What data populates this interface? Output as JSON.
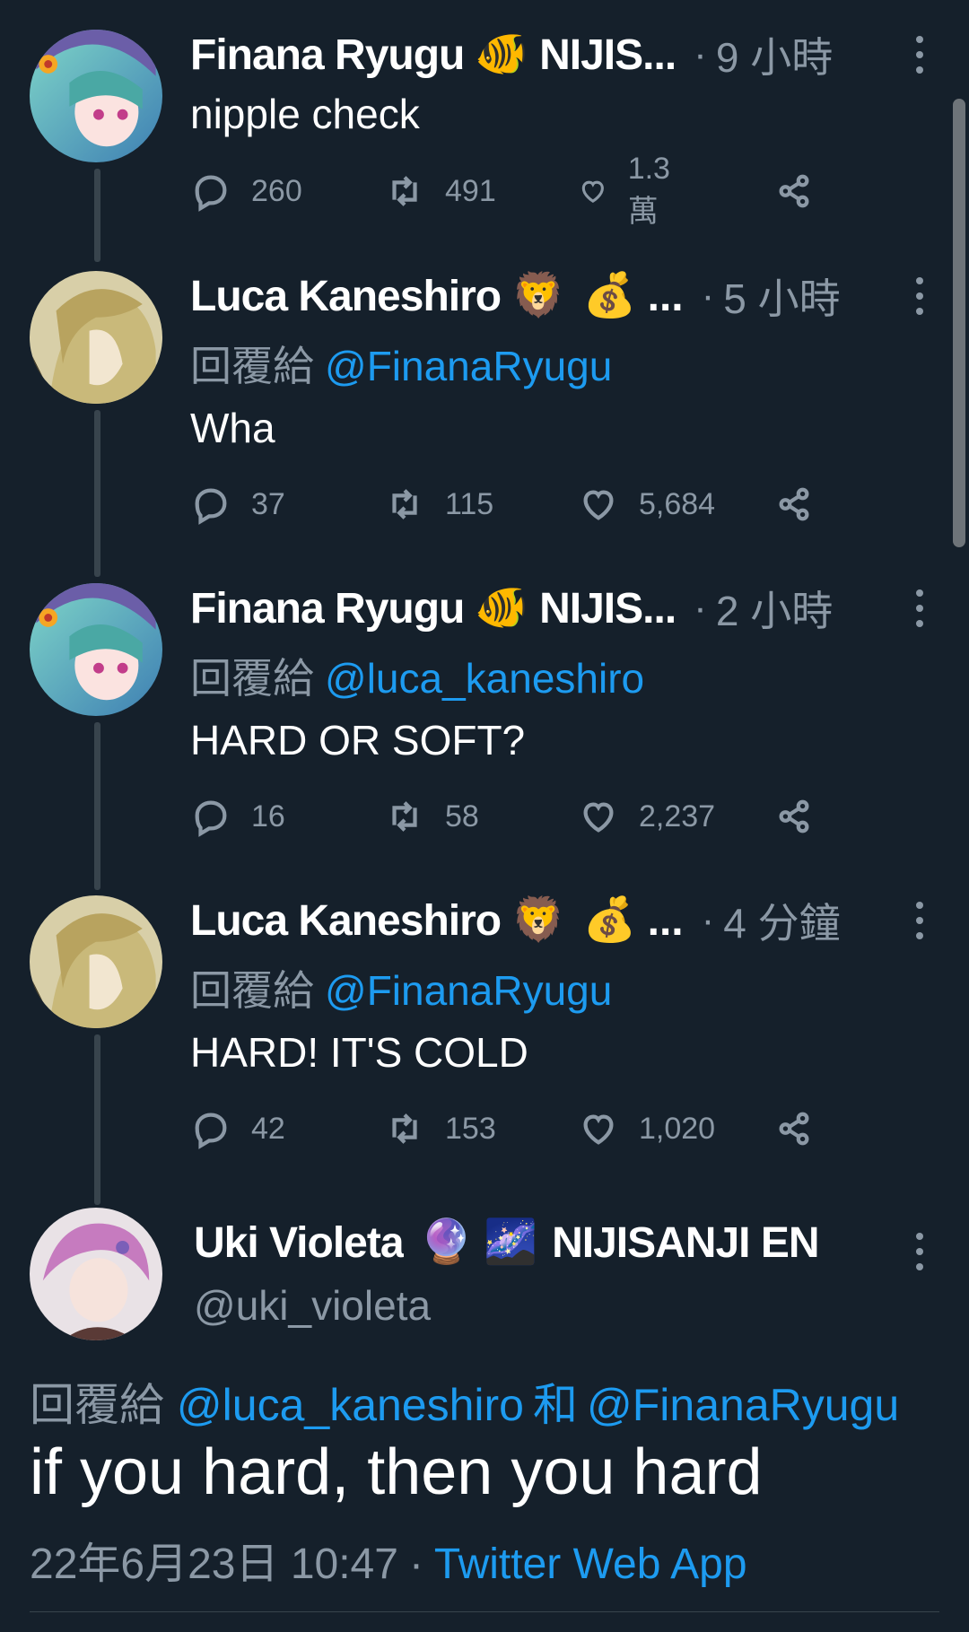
{
  "colors": {
    "background": "#15202b",
    "text_primary": "#ffffff",
    "text_secondary": "#8b98a5",
    "accent": "#1d9bf0",
    "thread_line": "#38444d"
  },
  "reply_prefix": "回覆給",
  "tweets": [
    {
      "name": "Finana Ryugu",
      "emoji": "🐠",
      "affiliation": "NIJIS...",
      "time": "9 小時",
      "reply_to": "",
      "text": "nipple check",
      "replies": "260",
      "retweets": "491",
      "likes": "1.3萬"
    },
    {
      "name": "Luca Kaneshiro",
      "emoji": "🦁",
      "emoji2": "💰",
      "affiliation": "...",
      "time": "5 小時",
      "reply_to": "@FinanaRyugu",
      "text": "Wha",
      "replies": "37",
      "retweets": "115",
      "likes": "5,684"
    },
    {
      "name": "Finana Ryugu",
      "emoji": "🐠",
      "affiliation": "NIJIS...",
      "time": "2 小時",
      "reply_to": "@luca_kaneshiro",
      "text": "HARD OR SOFT?",
      "replies": "16",
      "retweets": "58",
      "likes": "2,237"
    },
    {
      "name": "Luca Kaneshiro",
      "emoji": "🦁",
      "emoji2": "💰",
      "affiliation": "...",
      "time": "4 分鐘",
      "reply_to": "@FinanaRyugu",
      "text": "HARD! IT'S COLD",
      "replies": "42",
      "retweets": "153",
      "likes": "1,020"
    }
  ],
  "main_tweet": {
    "name": "Uki Violeta",
    "emoji": "🔮",
    "emoji2": "🌌",
    "affiliation": "NIJISANJI EN",
    "handle": "@uki_violeta",
    "reply_to_1": "@luca_kaneshiro",
    "conjunction": "和",
    "reply_to_2": "@FinanaRyugu",
    "text": "if you hard, then you hard",
    "timestamp": "22年6月23日 10:47",
    "separator": "·",
    "source": "Twitter Web App"
  },
  "icons": {
    "reply": "reply-icon",
    "retweet": "retweet-icon",
    "like": "heart-icon",
    "share": "share-icon",
    "more": "more-options-icon"
  }
}
